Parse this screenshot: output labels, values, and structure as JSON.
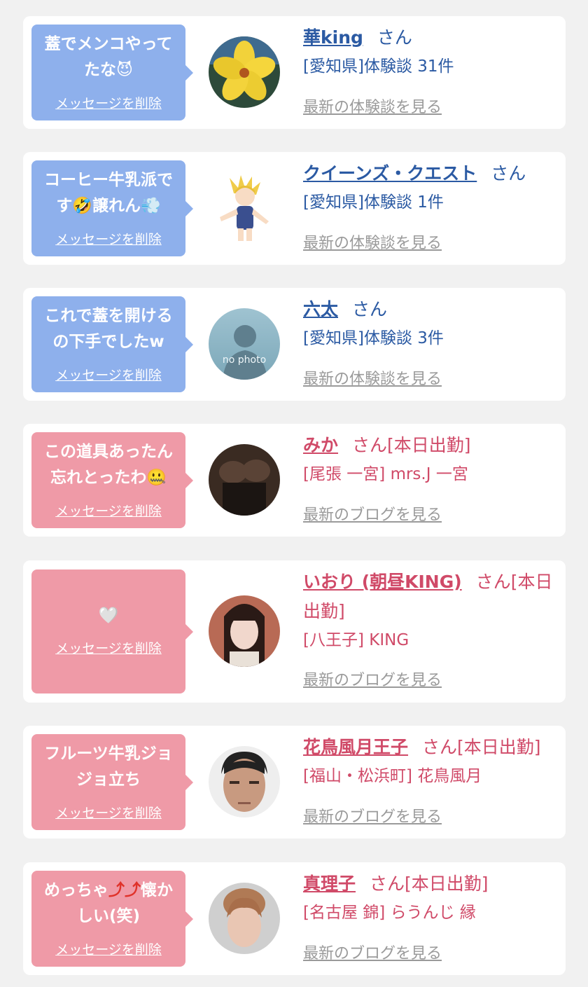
{
  "colors": {
    "blue_bubble": "#8eb0ec",
    "pink_bubble": "#ef9aa7",
    "blue_text": "#2b5aa3",
    "pink_text": "#d04a68",
    "link_gray": "#9a9a9a"
  },
  "delete_label": "メッセージを削除",
  "cards": [
    {
      "message": "蓋でメンコやってたな",
      "emoji": "😈",
      "name": "華king",
      "san": "さん",
      "sub": "[愛知県]体験談 31件",
      "latest": "最新の体験談を見る"
    },
    {
      "message_a": "コーヒー牛乳派です",
      "emoji_a": "🤣",
      "message_b": "譲れん",
      "emoji_b": "💨",
      "name": "クイーンズ・クエスト",
      "san": "さん",
      "sub": "[愛知県]体験談 1件",
      "latest": "最新の体験談を見る"
    },
    {
      "message": "これで蓋を開けるの下手でしたw",
      "name": "六太",
      "san": "さん",
      "sub": "[愛知県]体験談 3件",
      "latest": "最新の体験談を見る",
      "nophoto": "no photo"
    },
    {
      "message": "この道具あったん忘れとったわ",
      "emoji": "🤐",
      "name": "みか",
      "san": "さん[本日出勤]",
      "sub": "[尾張 一宮] mrs.J 一宮",
      "latest": "最新のブログを見る"
    },
    {
      "emoji": "🤍",
      "name": "いおり (朝昼KING)",
      "san": "さん[本日出勤]",
      "sub": "[八王子] KING",
      "latest": "最新のブログを見る"
    },
    {
      "message": "フルーツ牛乳ジョジョ立ち",
      "name": "花鳥風月王子",
      "san": "さん[本日出勤]",
      "sub": "[福山・松浜町] 花鳥風月",
      "latest": "最新のブログを見る"
    },
    {
      "message_a": "めっちゃ",
      "emoji_a": "⤴⤴",
      "message_b": "懐かしい(笑)",
      "name": "真理子",
      "san": "さん[本日出勤]",
      "sub": "[名古屋 錦] らうんじ 縁",
      "latest": "最新のブログを見る"
    }
  ]
}
